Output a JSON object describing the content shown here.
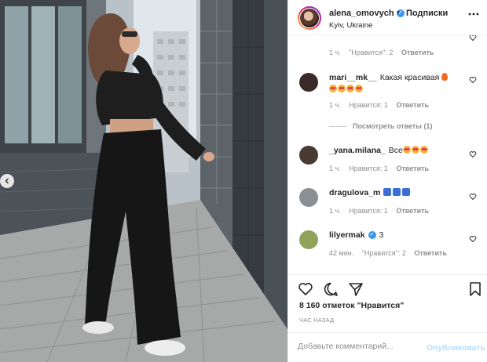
{
  "post": {
    "username": "alena_omovych",
    "follow_separator": "•",
    "follow_label": "Подписки",
    "location": "Kyiv, Ukraine",
    "more_icon": "more-dots-icon",
    "verified_mark": "✓"
  },
  "comments": [
    {
      "username": "",
      "text": "",
      "time": "1 ч.",
      "likes": "\"Нравится\": 2",
      "reply": "Ответить"
    },
    {
      "username": "mari__mk__",
      "text": "Какая красивая",
      "time": "1 ч.",
      "likes": "Нравится: 1",
      "reply": "Ответить",
      "avatar_color": "#3a2b28",
      "emoji": [
        "fire",
        "heart-eyes",
        "heart-eyes",
        "heart-eyes"
      ]
    },
    {
      "thread_label": "Посмотреть ответы (1)"
    },
    {
      "username": "_yana.milana_",
      "text": "Все",
      "time": "1 ч.",
      "likes": "Нравится: 1",
      "reply": "Ответить",
      "avatar_color": "#4a3a34",
      "emoji": [
        "heart-eyes",
        "heart-eyes",
        "heart-eyes"
      ]
    },
    {
      "username": "dragulova_m",
      "text": "",
      "time": "1 ч.",
      "likes": "Нравится: 1",
      "reply": "Ответить",
      "avatar_color": "#8a8f94",
      "emoji": [
        "blue-square",
        "blue-square",
        "blue-square"
      ]
    },
    {
      "username": "lilyermak",
      "text": "3",
      "time": "42 мин.",
      "likes": "\"Нравится\": 2",
      "reply": "Ответить",
      "avatar_color": "#8fa35a",
      "verified": true
    }
  ],
  "actions": {
    "like_icon": "heart-outline-icon",
    "comment_icon": "comment-bubble-icon",
    "share_icon": "paper-plane-icon",
    "save_icon": "bookmark-icon"
  },
  "likes_count": "8 160 отметок \"Нравится\"",
  "time_ago": "ЧАС НАЗАД",
  "add_comment": {
    "placeholder": "Добавьте комментарий...",
    "publish_label": "Опубликовать"
  },
  "colors": {
    "accent": "#3897f0",
    "publish_disabled": "#b2dffc",
    "muted": "#8e8e8e",
    "text": "#262626"
  }
}
